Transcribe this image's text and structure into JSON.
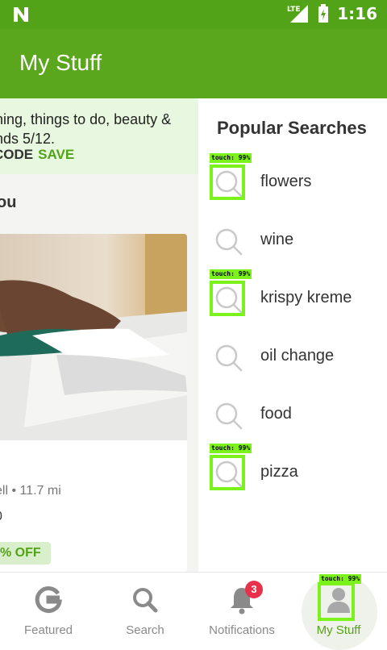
{
  "status_bar": {
    "network": "LTE",
    "time": "1:16"
  },
  "app_bar": {
    "title": "My Stuff"
  },
  "promo": {
    "line1": "hing, things to do, beauty &",
    "line2": "nds 5/12.",
    "code_label": "CODE",
    "save_label": "SAVE"
  },
  "section": {
    "title": "ou"
  },
  "deal_card": {
    "meta": "ell • 11.7 mi",
    "price": "0",
    "badge": "% OFF"
  },
  "popular": {
    "title": "Popular Searches",
    "items": [
      {
        "label": "flowers"
      },
      {
        "label": "wine"
      },
      {
        "label": "krispy kreme"
      },
      {
        "label": "oil change"
      },
      {
        "label": "food"
      },
      {
        "label": "pizza"
      }
    ],
    "touch_tag": "touch: 99%"
  },
  "bottom_nav": {
    "items": [
      {
        "label": "Featured",
        "icon": "g-logo-icon"
      },
      {
        "label": "Search",
        "icon": "search-icon"
      },
      {
        "label": "Notifications",
        "icon": "bell-icon"
      },
      {
        "label": "My Stuff",
        "icon": "person-icon"
      }
    ],
    "notification_count": "3"
  },
  "colors": {
    "brand": "#5aa61c",
    "touch_overlay": "#7cf21c",
    "badge": "#e8314a"
  }
}
